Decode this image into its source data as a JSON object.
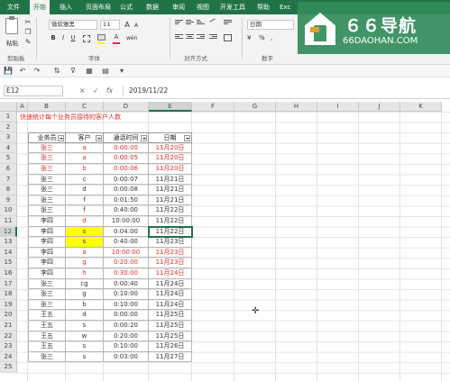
{
  "ribbon": {
    "tabs": [
      "文件",
      "开始",
      "插入",
      "页面布局",
      "公式",
      "数据",
      "审阅",
      "视图",
      "开发工具",
      "帮助",
      "Exc"
    ],
    "active_tab": "开始",
    "clipboard": {
      "paste_label": "粘贴",
      "group_label": "剪贴板"
    },
    "font": {
      "name": "微软雅黑",
      "size": "11",
      "group_label": "字体",
      "bold": "B",
      "italic": "I",
      "underline": "U",
      "grow": "A",
      "shrink": "A",
      "font_color": "A",
      "wen": "wén"
    },
    "alignment": {
      "group_label": "对齐方式"
    },
    "number": {
      "format": "日期",
      "percent": "%",
      "comma": ",",
      "currency": "¥",
      "group_label": "数字"
    }
  },
  "watermark": {
    "text": "６６导航",
    "url": "66DAOHAN.COM"
  },
  "formula_bar": {
    "name_box": "E12",
    "cancel": "×",
    "confirm": "✓",
    "fx": "fx",
    "content": "2019/11/22"
  },
  "columns": [
    "A",
    "B",
    "C",
    "D",
    "E",
    "F",
    "G",
    "H",
    "I",
    "J",
    "K"
  ],
  "rows": [
    "1",
    "2",
    "3",
    "4",
    "5",
    "6",
    "7",
    "8",
    "9",
    "10",
    "11",
    "12",
    "13",
    "14",
    "15",
    "16",
    "17",
    "18",
    "19",
    "20",
    "21",
    "22",
    "23",
    "24",
    "25"
  ],
  "sheet": {
    "title": "快速统计每个业务员接待的客户人数",
    "headers": [
      "业务员",
      "客户",
      "通话时间",
      "日期"
    ],
    "records": [
      {
        "agent": "张三",
        "customer": "a",
        "duration": "0:00:00",
        "date": "11月20日",
        "red": true,
        "yellow": false
      },
      {
        "agent": "张三",
        "customer": "a",
        "duration": "0:00:05",
        "date": "11月20日",
        "red": true,
        "yellow": false
      },
      {
        "agent": "张三",
        "customer": "b",
        "duration": "0:00:06",
        "date": "11月20日",
        "red": true,
        "yellow": false
      },
      {
        "agent": "张三",
        "customer": "c",
        "duration": "0:00:07",
        "date": "11月21日",
        "red": false,
        "yellow": false
      },
      {
        "agent": "张三",
        "customer": "d",
        "duration": "0:00:08",
        "date": "11月21日",
        "red": false,
        "yellow": false
      },
      {
        "agent": "张三",
        "customer": "f",
        "duration": "0:01:50",
        "date": "11月21日",
        "red": false,
        "yellow": false
      },
      {
        "agent": "张三",
        "customer": "f",
        "duration": "0:40:00",
        "date": "11月22日",
        "red": false,
        "yellow": false
      },
      {
        "agent": "李四",
        "customer": "d",
        "duration": "10:00:00",
        "date": "11月22日",
        "red": false,
        "yellow": false,
        "customer_red": true
      },
      {
        "agent": "李四",
        "customer": "s",
        "duration": "0:04:00",
        "date": "11月22日",
        "red": false,
        "yellow": true
      },
      {
        "agent": "李四",
        "customer": "s",
        "duration": "0:40:00",
        "date": "11月23日",
        "red": false,
        "yellow": true
      },
      {
        "agent": "李四",
        "customer": "a",
        "duration": "10:00:00",
        "date": "11月23日",
        "red": true,
        "yellow": false,
        "agent_black": true
      },
      {
        "agent": "李四",
        "customer": "g",
        "duration": "0:20:00",
        "date": "11月23日",
        "red": true,
        "yellow": false,
        "agent_black": true
      },
      {
        "agent": "李四",
        "customer": "h",
        "duration": "0:30:00",
        "date": "11月24日",
        "red": true,
        "yellow": false,
        "agent_black": true
      },
      {
        "agent": "张三",
        "customer": "cg",
        "duration": "0:00:40",
        "date": "11月24日",
        "red": false,
        "yellow": false
      },
      {
        "agent": "张三",
        "customer": "g",
        "duration": "0:10:00",
        "date": "11月24日",
        "red": false,
        "yellow": false
      },
      {
        "agent": "张三",
        "customer": "b",
        "duration": "0:10:00",
        "date": "11月24日",
        "red": false,
        "yellow": false
      },
      {
        "agent": "王五",
        "customer": "d",
        "duration": "0:00:00",
        "date": "11月25日",
        "red": false,
        "yellow": false
      },
      {
        "agent": "王五",
        "customer": "s",
        "duration": "0:00:20",
        "date": "11月25日",
        "red": false,
        "yellow": false
      },
      {
        "agent": "王五",
        "customer": "w",
        "duration": "0:20:00",
        "date": "11月25日",
        "red": false,
        "yellow": false
      },
      {
        "agent": "王五",
        "customer": "s",
        "duration": "0:10:00",
        "date": "11月26日",
        "red": false,
        "yellow": false
      },
      {
        "agent": "张三",
        "customer": "s",
        "duration": "0:03:00",
        "date": "11月27日",
        "red": false,
        "yellow": false
      }
    ]
  },
  "colors": {
    "accent": "#217346",
    "highlight_red": "#e02a2a",
    "highlight_yellow": "#ffff00"
  }
}
